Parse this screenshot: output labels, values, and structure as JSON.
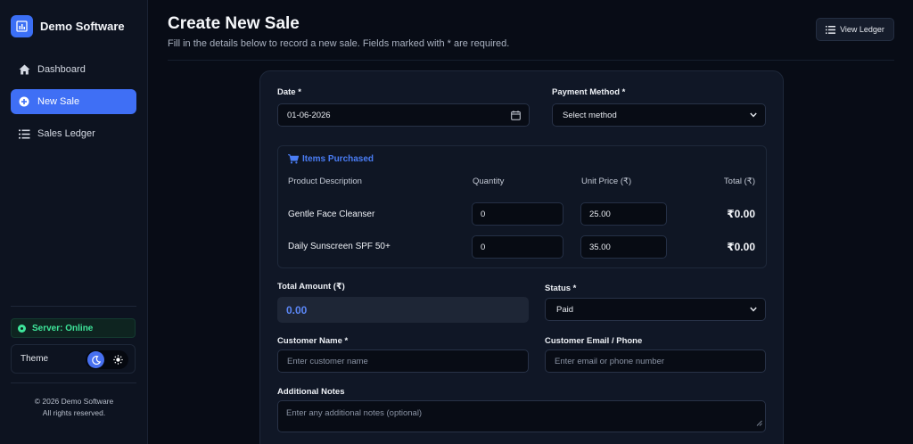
{
  "app": {
    "name": "Demo Software"
  },
  "sidebar": {
    "items": [
      {
        "label": "Dashboard",
        "icon": "home-icon",
        "active": false
      },
      {
        "label": "New Sale",
        "icon": "plus-circle-icon",
        "active": true
      },
      {
        "label": "Sales Ledger",
        "icon": "list-icon",
        "active": false
      }
    ],
    "server_status": "Server: Online",
    "theme_label": "Theme",
    "copyright_line1": "© 2026 Demo Software",
    "copyright_line2": "All rights reserved."
  },
  "header": {
    "title": "Create New Sale",
    "subtitle": "Fill in the details below to record a new sale. Fields marked with * are required.",
    "view_ledger_label": "View Ledger"
  },
  "form": {
    "date_label": "Date *",
    "date_value": "01-06-2026",
    "payment_label": "Payment Method *",
    "payment_value": "Select method",
    "items_title": "Items Purchased",
    "columns": [
      "Product Description",
      "Quantity",
      "Unit Price (₹)",
      "Total (₹)"
    ],
    "items": [
      {
        "name": "Gentle Face Cleanser",
        "quantity": "0",
        "unit_price": "25.00",
        "total": "₹0.00"
      },
      {
        "name": "Daily Sunscreen SPF 50+",
        "quantity": "0",
        "unit_price": "35.00",
        "total": "₹0.00"
      }
    ],
    "total_label": "Total Amount (₹)",
    "total_value": "0.00",
    "status_label": "Status *",
    "status_value": "Paid",
    "customer_name_label": "Customer Name *",
    "customer_name_placeholder": "Enter customer name",
    "customer_contact_label": "Customer Email / Phone",
    "customer_contact_placeholder": "Enter email or phone number",
    "notes_label": "Additional Notes",
    "notes_placeholder": "Enter any additional notes (optional)"
  },
  "colors": {
    "accent": "#3f6ff5",
    "success": "#3ee59a",
    "background": "#080c16",
    "card": "#101726"
  }
}
